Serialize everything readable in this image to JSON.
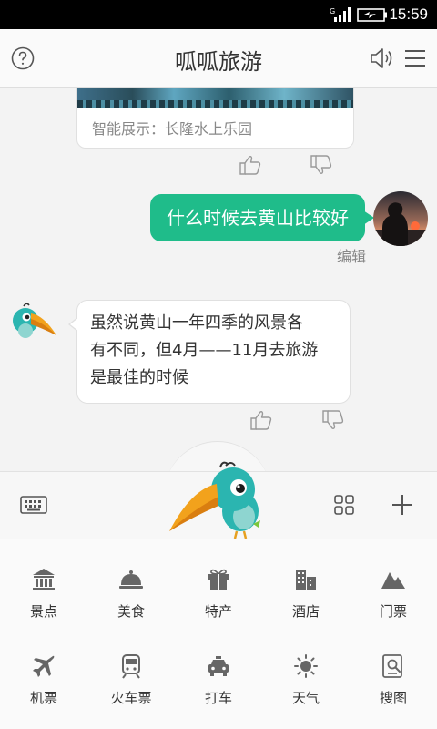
{
  "status_bar": {
    "time": "15:59",
    "network": "G"
  },
  "header": {
    "title": "呱呱旅游"
  },
  "chat": {
    "card_caption": "智能展示：长隆水上乐园",
    "user_message": "什么时候去黄山比较好",
    "edit_label": "编辑",
    "bot_message_lines": [
      "虽然说黄山一年四季的风景各",
      "有不同，但4月——11月去旅游",
      "是最佳的时候"
    ]
  },
  "services": [
    {
      "label": "景点",
      "icon": "landmark-icon"
    },
    {
      "label": "美食",
      "icon": "food-cloche-icon"
    },
    {
      "label": "特产",
      "icon": "gift-icon"
    },
    {
      "label": "酒店",
      "icon": "hotel-building-icon"
    },
    {
      "label": "门票",
      "icon": "mountain-ticket-icon"
    },
    {
      "label": "机票",
      "icon": "airplane-icon"
    },
    {
      "label": "火车票",
      "icon": "train-icon"
    },
    {
      "label": "打车",
      "icon": "taxi-icon"
    },
    {
      "label": "天气",
      "icon": "sun-icon"
    },
    {
      "label": "搜图",
      "icon": "image-search-icon"
    }
  ]
}
